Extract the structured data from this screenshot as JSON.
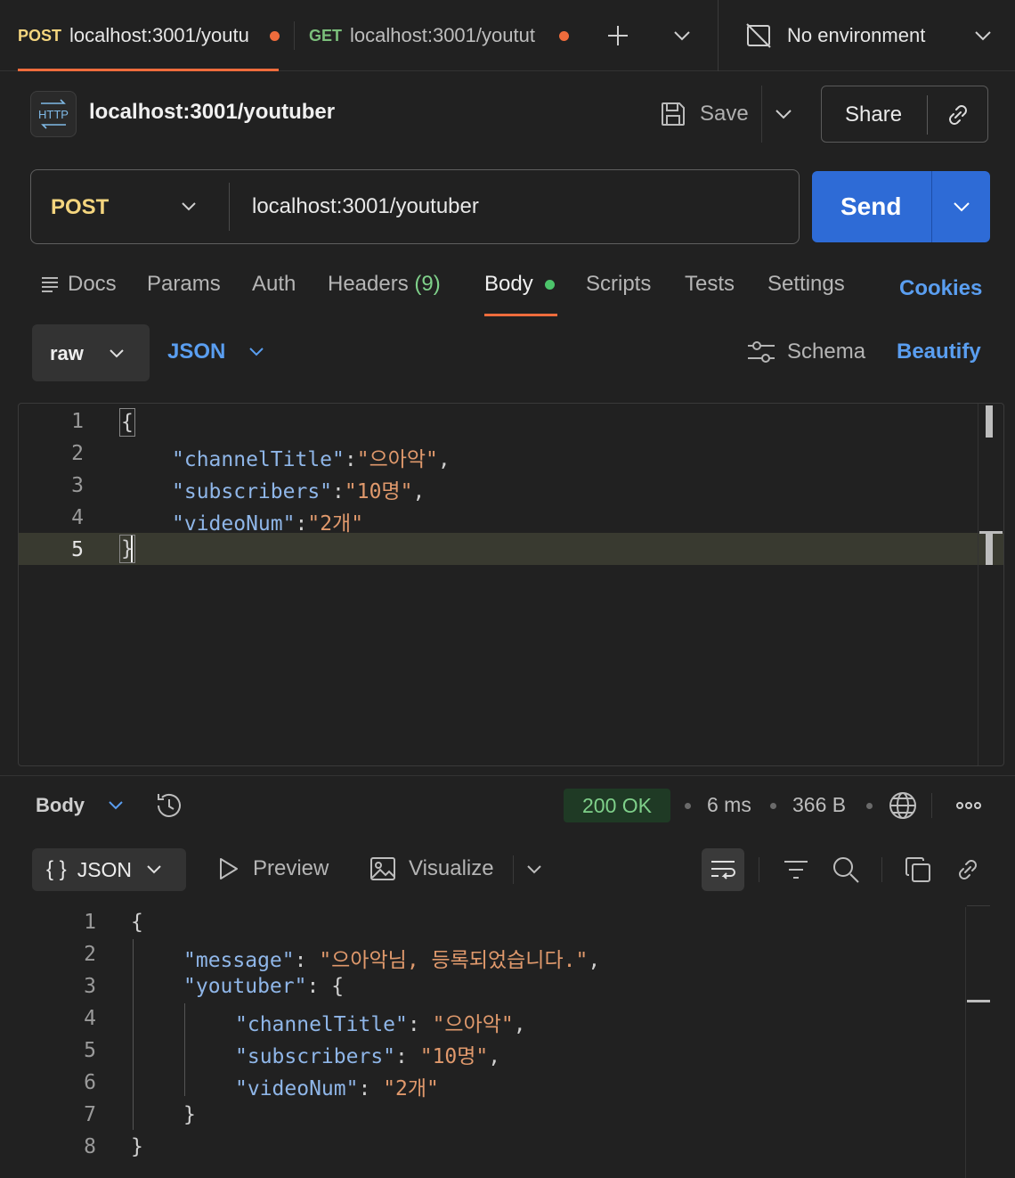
{
  "tabs": [
    {
      "method": "POST",
      "url": "localhost:3001/youtu",
      "method_color": "#f4d57e",
      "active": true
    },
    {
      "method": "GET",
      "url": "localhost:3001/youtut",
      "method_color": "#7bbf7b",
      "active": false
    }
  ],
  "environment": {
    "label": "No environment"
  },
  "header": {
    "http_badge": "HTTP",
    "title": "localhost:3001/youtuber",
    "save_label": "Save",
    "share_label": "Share"
  },
  "request": {
    "method": "POST",
    "url": "localhost:3001/youtuber",
    "send_label": "Send"
  },
  "subtabs": {
    "docs": "Docs",
    "params": "Params",
    "auth": "Auth",
    "headers": "Headers",
    "headers_count": "(9)",
    "body": "Body",
    "scripts": "Scripts",
    "tests": "Tests",
    "settings": "Settings",
    "cookies": "Cookies"
  },
  "body_options": {
    "mode": "raw",
    "format": "JSON",
    "schema": "Schema",
    "beautify": "Beautify"
  },
  "request_body": {
    "line_numbers": [
      "1",
      "2",
      "3",
      "4",
      "5"
    ],
    "open_brace": "{",
    "close_brace": "}",
    "fields": [
      {
        "key": "\"channelTitle\"",
        "sep": ":",
        "value": "\"으아악\"",
        "trail": ","
      },
      {
        "key": "\"subscribers\"",
        "sep": ":",
        "value": "\"10명\"",
        "trail": ","
      },
      {
        "key": "\"videoNum\"",
        "sep": ":",
        "value": "\"2개\"",
        "trail": ""
      }
    ]
  },
  "response": {
    "body_label": "Body",
    "status": "200 OK",
    "time": "6 ms",
    "size": "366 B",
    "format": "JSON",
    "format_glyph": "{ }",
    "preview": "Preview",
    "visualize": "Visualize",
    "line_numbers": [
      "1",
      "2",
      "3",
      "4",
      "5",
      "6",
      "7",
      "8"
    ],
    "lines": {
      "l1": "{",
      "l2_key": "\"message\"",
      "l2_sep": ": ",
      "l2_val": "\"으아악님, 등록되었습니다.\"",
      "l2_trail": ",",
      "l3_key": "\"youtuber\"",
      "l3_sep": ": ",
      "l3_open": "{",
      "l4_key": "\"channelTitle\"",
      "l4_sep": ": ",
      "l4_val": "\"으아악\"",
      "l4_trail": ",",
      "l5_key": "\"subscribers\"",
      "l5_sep": ": ",
      "l5_val": "\"10명\"",
      "l5_trail": ",",
      "l6_key": "\"videoNum\"",
      "l6_sep": ": ",
      "l6_val": "\"2개\"",
      "l7": "}",
      "l8": "}"
    }
  },
  "colors": {
    "accent": "#ef6c3c",
    "send": "#2e6bd6",
    "link": "#5a9ef0",
    "ok_bg": "#1f3a25",
    "ok_text": "#7fd08a"
  }
}
